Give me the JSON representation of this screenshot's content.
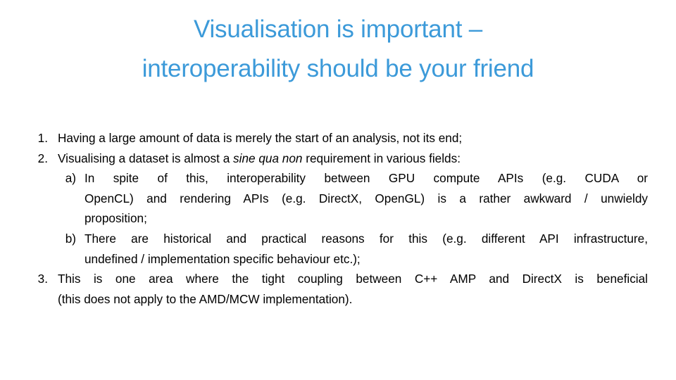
{
  "slide": {
    "background_color": "#ffffff",
    "title": {
      "color": "#3C9AD9",
      "line1": "Visualisation is important –",
      "line2": "interoperability should be your friend"
    },
    "body": {
      "text_color": "#000000",
      "items": [
        {
          "marker": "1.",
          "level": 1,
          "lines": [
            "Having a large amount of data is merely the start of an analysis, not its end;"
          ]
        },
        {
          "marker": "2.",
          "level": 1,
          "text_before_italic": "Visualising a dataset is almost a ",
          "italic_text": "sine qua non",
          "text_after_italic": " requirement in various fields:"
        },
        {
          "marker": "a)",
          "level": 2,
          "lines": [
            "In spite of this, interoperability between GPU compute APIs (e.g. CUDA or",
            "OpenCL) and rendering APIs (e.g. DirectX, OpenGL) is a rather awkward / unwieldy",
            "proposition;"
          ]
        },
        {
          "marker": "b)",
          "level": 2,
          "lines": [
            "There are historical and practical reasons for this (e.g. different API infrastructure,",
            "undefined / implementation specific behaviour etc.);"
          ]
        },
        {
          "marker": "3.",
          "level": 1,
          "lines": [
            "This is one area where the tight coupling between C++ AMP and DirectX is beneficial",
            "(this does not apply to the AMD/MCW implementation)."
          ]
        }
      ]
    }
  }
}
